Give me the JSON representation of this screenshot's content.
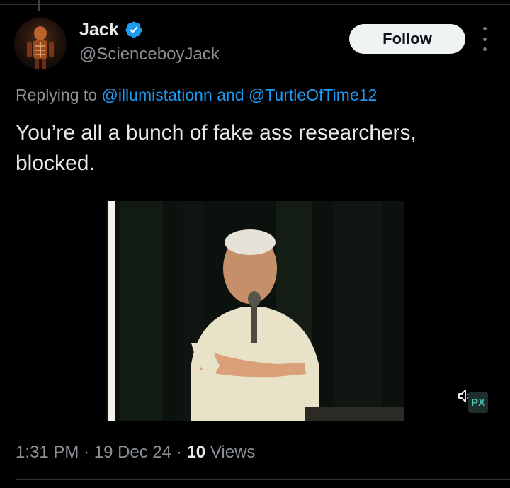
{
  "author": {
    "display_name": "Jack",
    "handle": "@ScienceboyJack",
    "verified": true,
    "avatar_icon": "avatar-image",
    "verified_color": "#1d9bf0"
  },
  "actions": {
    "follow_label": "Follow",
    "more_icon": "more-dots-icon"
  },
  "reply_context": {
    "prefix": "Replying to ",
    "mention_1": "@illumistationn",
    "joiner": " and ",
    "mention_2": "@TurtleOfTime12"
  },
  "tweet": {
    "text": "You’re all a bunch of fake ass researchers, blocked."
  },
  "media": {
    "type": "video",
    "mute_icon": "muted-speaker-icon",
    "badge_text": "PX"
  },
  "meta": {
    "time": "1:31 PM",
    "separator": " · ",
    "date": "19 Dec 24",
    "views_count": "10",
    "views_label": " Views"
  },
  "colors": {
    "background": "#000000",
    "text": "#e7e9ea",
    "secondary": "#8b9196",
    "link": "#1d9bf0"
  }
}
